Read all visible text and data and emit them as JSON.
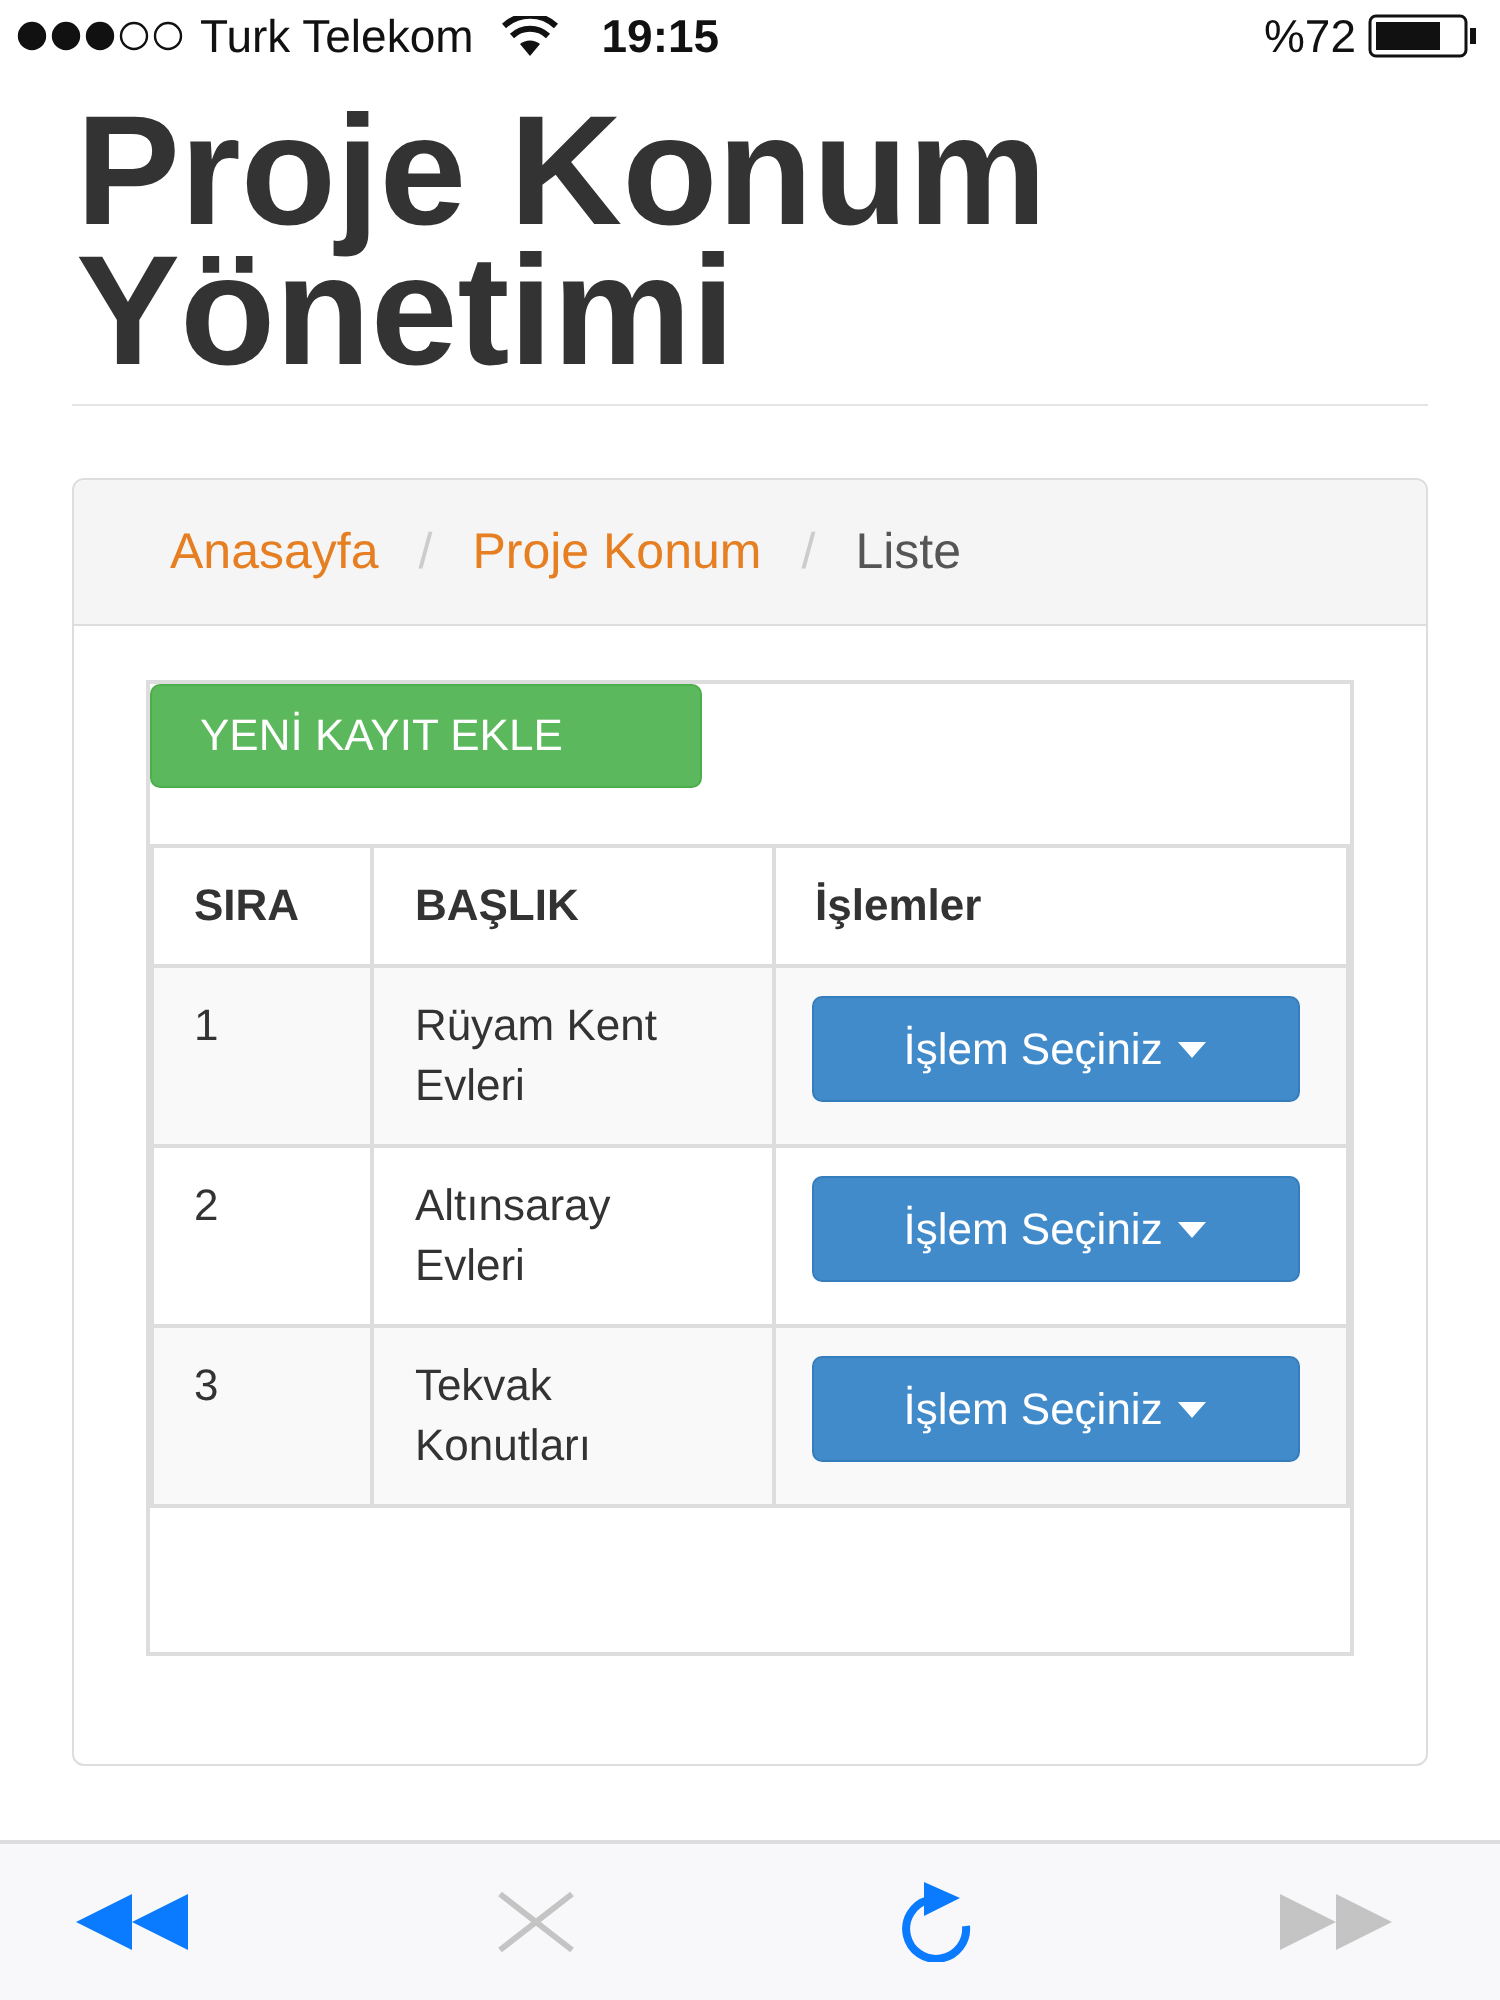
{
  "status_bar": {
    "carrier": "Turk Telekom",
    "time": "19:15",
    "battery": "%72"
  },
  "page_title": "Proje Konum Yönetimi",
  "breadcrumb_separator": "/",
  "breadcrumb": [
    {
      "label": "Anasayfa",
      "link": true
    },
    {
      "label": "Proje Konum",
      "link": true
    },
    {
      "label": "Liste",
      "link": false
    }
  ],
  "add_button": "YENİ KAYIT EKLE",
  "table": {
    "columns": [
      "SIRA",
      "BAŞLIK",
      "İşlemler"
    ],
    "rows": [
      {
        "no": "1",
        "title": "Rüyam Kent Evleri",
        "action": "İşlem Seçiniz"
      },
      {
        "no": "2",
        "title": "Altınsaray Evleri",
        "action": "İşlem Seçiniz"
      },
      {
        "no": "3",
        "title": "Tekvak Konutları",
        "action": "İşlem Seçiniz"
      }
    ]
  },
  "toolbar": [
    {
      "kind": "back",
      "disabled": false
    },
    {
      "kind": "stop",
      "disabled": true
    },
    {
      "kind": "reload",
      "disabled": false
    },
    {
      "kind": "forward",
      "disabled": true
    }
  ]
}
